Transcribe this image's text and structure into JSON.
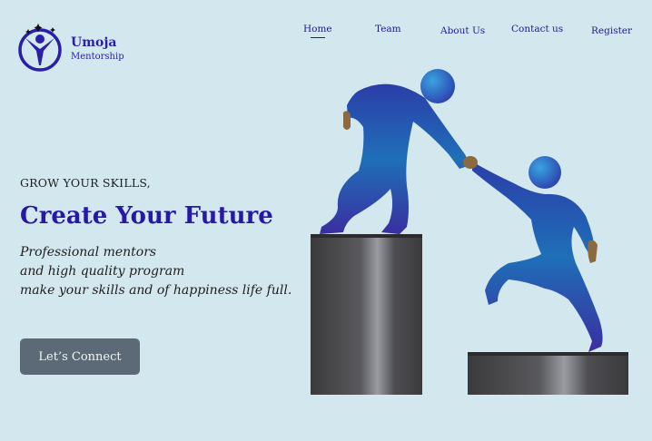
{
  "brand": {
    "name": "Umoja",
    "subtitle": "Mentorship"
  },
  "nav": {
    "items": [
      {
        "label": "Home",
        "active": true
      },
      {
        "label": "Team",
        "active": false
      },
      {
        "label": "About Us",
        "active": false
      },
      {
        "label": "Contact us",
        "active": false
      },
      {
        "label": "Register",
        "active": false
      }
    ]
  },
  "hero": {
    "eyebrow": "GROW YOUR SKILLS,",
    "headline": "Create Your Future",
    "tagline": [
      "Professional mentors",
      "and high quality program",
      "make your skills and of happiness life full."
    ],
    "cta_label": "Let’s Connect"
  },
  "colors": {
    "background": "#d3e8ee",
    "brand": "#2a1fa6",
    "headline": "#2718a8",
    "button": "#5b6a76"
  },
  "icons": [
    "logo-person-stars-icon",
    "mentor-helping-illustration"
  ]
}
